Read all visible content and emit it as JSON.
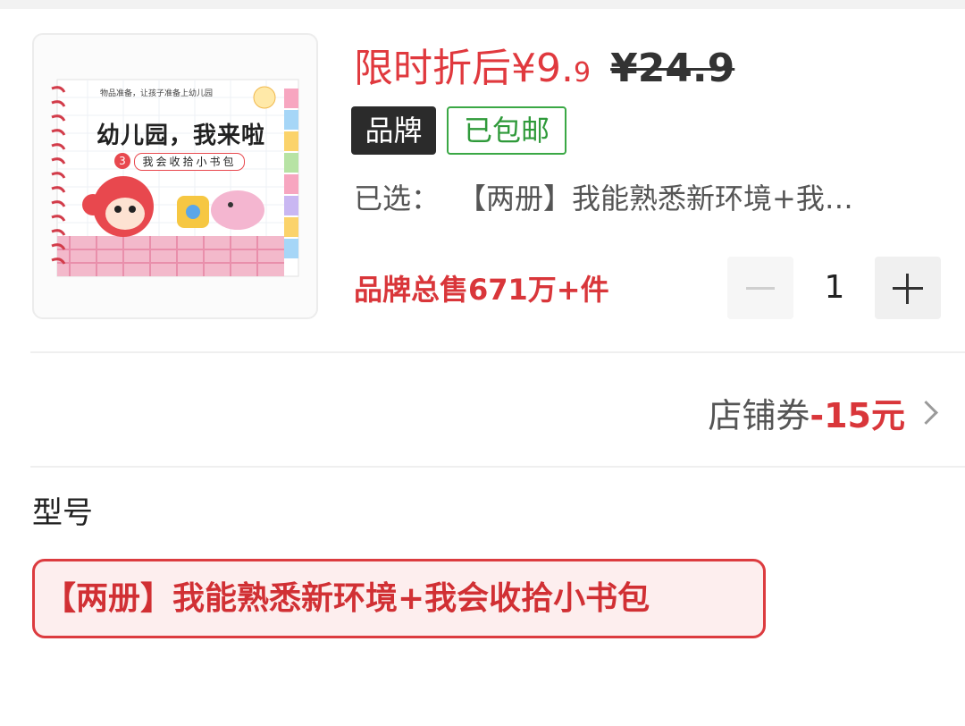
{
  "product": {
    "thumbnail_icon": "book-cover-image",
    "cover_top_text": "物品准备，让孩子准备上幼儿园",
    "cover_title": "幼儿园，我来啦",
    "cover_volume_no": "3",
    "cover_subtitle": "我会收拾小书包"
  },
  "price": {
    "label": "限时折后",
    "currency": "¥",
    "integer": "9.",
    "decimal": "9",
    "original": "¥24.9"
  },
  "tags": {
    "brand": "品牌",
    "free_shipping": "已包邮"
  },
  "selection": {
    "label": "已选：",
    "value": "【两册】我能熟悉新环境+我…"
  },
  "sales": {
    "text": "品牌总售671万+件"
  },
  "quantity": {
    "value": "1",
    "minus_icon": "minus-icon",
    "plus_icon": "plus-icon"
  },
  "coupon": {
    "label": "店铺券",
    "amount": "-15元",
    "chevron_icon": "chevron-right-icon"
  },
  "model": {
    "label": "型号",
    "option": "【两册】我能熟悉新环境+我会收拾小书包"
  },
  "colors": {
    "accent_red": "#e0393e",
    "shipping_green": "#3aa845",
    "brand_tag_bg": "#2b2b2b"
  }
}
